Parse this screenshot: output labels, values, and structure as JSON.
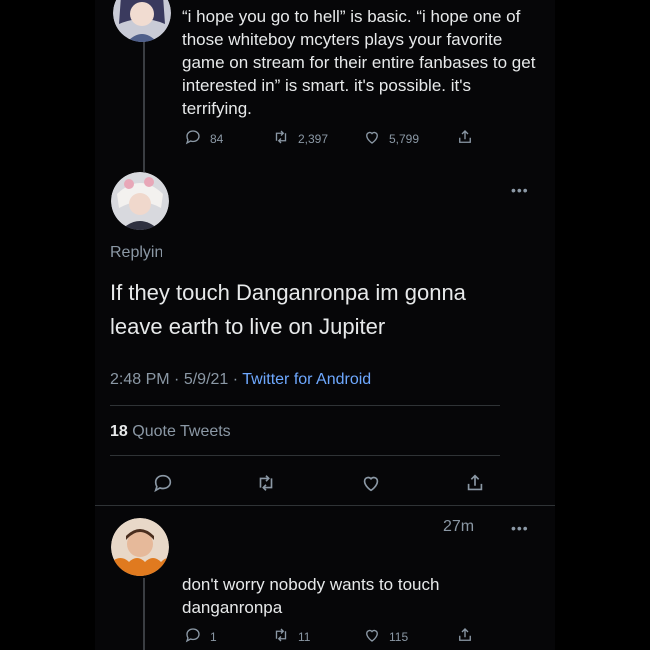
{
  "top_tweet": {
    "text": "“i hope you go to hell” is basic. “i hope one of those whiteboy mcyters plays your favorite game on stream for their entire fanbases to get interested in” is smart. it's possible. it's terrifying.",
    "replies": "84",
    "retweets": "2,397",
    "likes": "5,799"
  },
  "main_tweet": {
    "replying": "Replying",
    "text": "If they touch Danganronpa im gonna leave earth to live on Jupiter",
    "time": "2:48 PM",
    "date": "5/9/21",
    "source": "Twitter for Android",
    "quote_count": "18",
    "quote_label": "Quote Tweets"
  },
  "reply_tweet": {
    "age": "27m",
    "text": "don't worry nobody wants to touch danganronpa",
    "replies": "1",
    "retweets": "11",
    "likes": "115"
  },
  "icons": [
    "comment-icon",
    "retweet-icon",
    "heart-icon",
    "share-icon",
    "more-icon"
  ],
  "colors": {
    "background": "#000000",
    "text": "#e7e9ea",
    "muted": "#8b98a5",
    "link": "#6ea8fe",
    "divider": "#2f3336"
  }
}
